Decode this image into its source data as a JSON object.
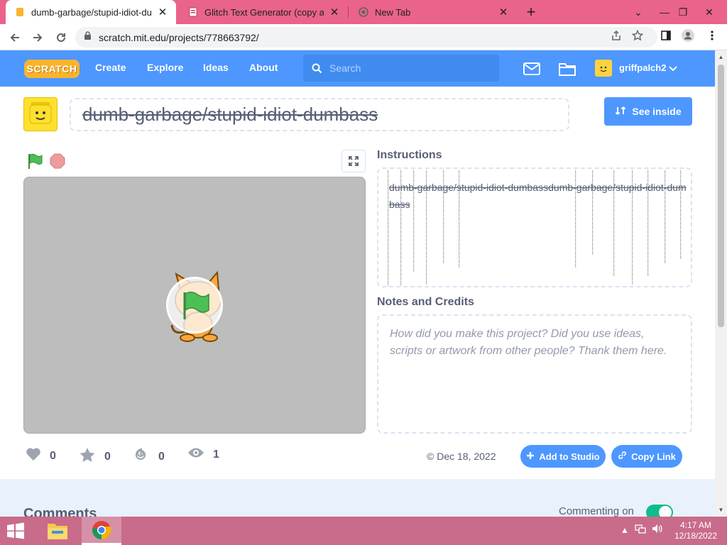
{
  "browser": {
    "tabs": [
      {
        "title": "dumb-garbage/stupid-idiot-dumb",
        "active": true
      },
      {
        "title": "Glitch Text Generator (copy and",
        "active": false
      },
      {
        "title": "New Tab",
        "active": false
      }
    ],
    "url": "scratch.mit.edu/projects/778663792/"
  },
  "scratch_nav": {
    "logo": "SCRATCH",
    "links": [
      "Create",
      "Explore",
      "Ideas",
      "About"
    ],
    "search_placeholder": "Search",
    "username": "griffpalch2"
  },
  "project": {
    "title": "dumb-garbage/stupid-idiot-dumbass",
    "see_inside": "See inside",
    "instructions_heading": "Instructions",
    "instructions_text": "dumb-garbage/stupid-idiot-dumbassdumb-garbage/stupid-idiot-dumbass",
    "notes_heading": "Notes and Credits",
    "notes_placeholder": "How did you make this project? Did you use ideas, scripts or artwork from other people? Thank them here.",
    "stats": {
      "loves": "0",
      "favorites": "0",
      "remixes": "0",
      "views": "1"
    },
    "date": "Dec 18, 2022",
    "add_to_studio": "Add to Studio",
    "copy_link": "Copy Link"
  },
  "comments": {
    "title": "Comments",
    "commenting_label": "Commenting on",
    "commenting_enabled": true
  },
  "taskbar": {
    "time": "4:17 AM",
    "date": "12/18/2022"
  },
  "colors": {
    "tab_strip": "#e9638a",
    "scratch_blue": "#4d97ff",
    "taskbar": "#c96b8a",
    "toggle_on": "#0fbd8c"
  }
}
